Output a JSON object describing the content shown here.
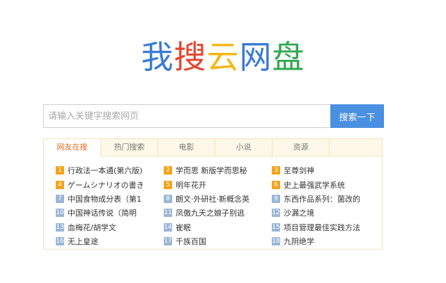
{
  "logo": {
    "chars": [
      {
        "char": "我",
        "color": "#3a7bd5"
      },
      {
        "char": "搜",
        "color": "#e8432e"
      },
      {
        "char": "云",
        "color": "#f6b714"
      },
      {
        "char": "网",
        "color": "#3a7bd5"
      },
      {
        "char": "盘",
        "color": "#34a853"
      }
    ]
  },
  "search": {
    "placeholder": "请输入关键字搜索网页",
    "button_label": "搜索一下"
  },
  "tabs": [
    {
      "label": "网友在搜",
      "active": true
    },
    {
      "label": "热门搜索",
      "active": false
    },
    {
      "label": "电影",
      "active": false
    },
    {
      "label": "小说",
      "active": false
    },
    {
      "label": "资源",
      "active": false
    }
  ],
  "items": [
    {
      "num": "1",
      "text": "行政法一本通(第六版)",
      "hot": true
    },
    {
      "num": "2",
      "text": "学而思 新版学而思秘",
      "hot": true
    },
    {
      "num": "3",
      "text": "至尊剑神",
      "hot": true
    },
    {
      "num": "4",
      "text": "ゲームシナリオの書き",
      "hot": true
    },
    {
      "num": "5",
      "text": "明年花开",
      "hot": true
    },
    {
      "num": "6",
      "text": "史上最强武学系统",
      "hot": true
    },
    {
      "num": "7",
      "text": "中国食物成分表（第1",
      "hot": false
    },
    {
      "num": "8",
      "text": "朗文·外研社·新概念英",
      "hot": false
    },
    {
      "num": "9",
      "text": "东西作品系列：菌改的",
      "hot": false
    },
    {
      "num": "10",
      "text": "中国神话传说（简明",
      "hot": false
    },
    {
      "num": "11",
      "text": "凤傲九天之娘子别逃",
      "hot": false
    },
    {
      "num": "12",
      "text": "沙漏之境",
      "hot": false
    },
    {
      "num": "13",
      "text": "血梅花/胡学文",
      "hot": false
    },
    {
      "num": "14",
      "text": "崔眠",
      "hot": false
    },
    {
      "num": "15",
      "text": "项目管理最佳实践方法",
      "hot": false
    },
    {
      "num": "16",
      "text": "无上皇途",
      "hot": false
    },
    {
      "num": "17",
      "text": "千族百国",
      "hot": false
    },
    {
      "num": "18",
      "text": "九阴绝学",
      "hot": false
    }
  ],
  "colors": {
    "accent": "#4a90e2",
    "active_tab_text": "#e06a22",
    "hot_badge": "#f5a31a",
    "normal_badge": "#9ab6d6"
  }
}
